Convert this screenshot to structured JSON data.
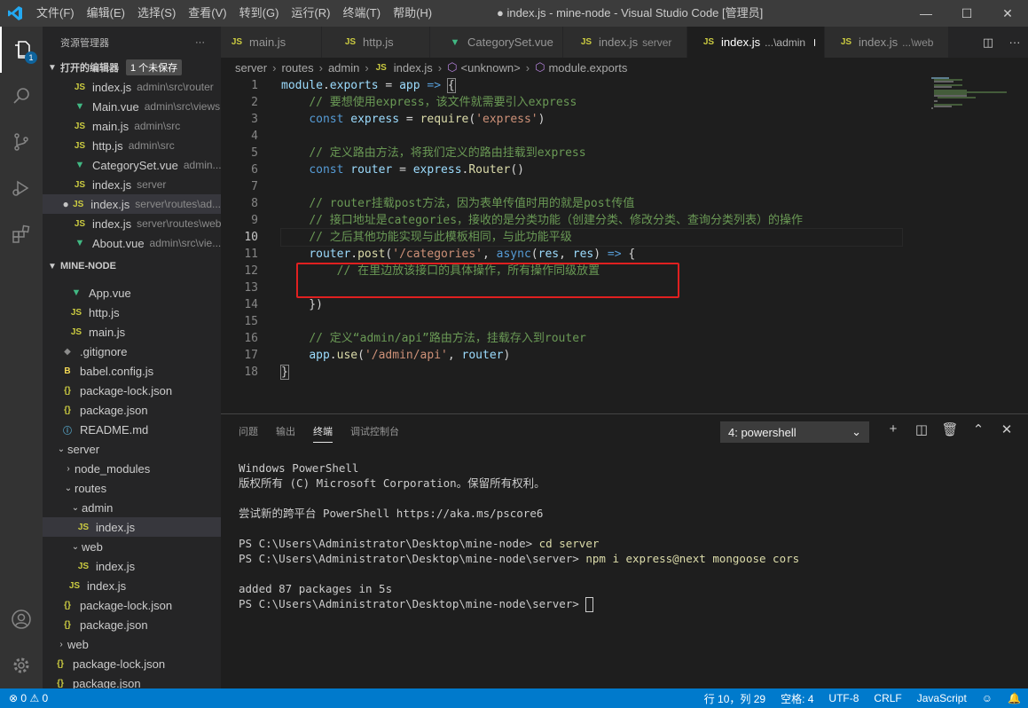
{
  "titlebar": {
    "menu": [
      "文件(F)",
      "编辑(E)",
      "选择(S)",
      "查看(V)",
      "转到(G)",
      "运行(R)",
      "终端(T)",
      "帮助(H)"
    ],
    "title": "● index.js - mine-node - Visual Studio Code [管理员]"
  },
  "activity": {
    "badge": "1"
  },
  "sidebar": {
    "header": "资源管理器",
    "open_editors_title": "打开的编辑器",
    "unsaved_badge": "1 个未保存",
    "open_editors": [
      {
        "name": "index.js",
        "desc": "admin\\src\\router",
        "icon": "JS"
      },
      {
        "name": "Main.vue",
        "desc": "admin\\src\\views",
        "icon": "V"
      },
      {
        "name": "main.js",
        "desc": "admin\\src",
        "icon": "JS"
      },
      {
        "name": "http.js",
        "desc": "admin\\src",
        "icon": "JS"
      },
      {
        "name": "CategorySet.vue",
        "desc": "admin...",
        "icon": "V"
      },
      {
        "name": "index.js",
        "desc": "server",
        "icon": "JS"
      },
      {
        "name": "index.js",
        "desc": "server\\routes\\ad...",
        "icon": "JS"
      },
      {
        "name": "index.js",
        "desc": "server\\routes\\web",
        "icon": "JS"
      },
      {
        "name": "About.vue",
        "desc": "admin\\src\\vie...",
        "icon": "V"
      }
    ],
    "project_title": "MINE-NODE",
    "tree": [
      {
        "name": "App.vue",
        "icon": "V"
      },
      {
        "name": "http.js",
        "icon": "JS"
      },
      {
        "name": "main.js",
        "icon": "JS"
      },
      {
        "name": ".gitignore",
        "icon": "git"
      },
      {
        "name": "babel.config.js",
        "icon": "babel"
      },
      {
        "name": "package-lock.json",
        "icon": "{}"
      },
      {
        "name": "package.json",
        "icon": "{}"
      },
      {
        "name": "README.md",
        "icon": "i"
      },
      {
        "name": "server",
        "icon": "folder-open"
      },
      {
        "name": "node_modules",
        "icon": "folder"
      },
      {
        "name": "routes",
        "icon": "folder-open"
      },
      {
        "name": "admin",
        "icon": "folder-open"
      },
      {
        "name": "index.js",
        "icon": "JS"
      },
      {
        "name": "web",
        "icon": "folder-open"
      },
      {
        "name": "index.js",
        "icon": "JS"
      },
      {
        "name": "index.js",
        "icon": "JS"
      },
      {
        "name": "package-lock.json",
        "icon": "{}"
      },
      {
        "name": "package.json",
        "icon": "{}"
      },
      {
        "name": "web",
        "icon": "folder"
      },
      {
        "name": "package-lock.json",
        "icon": "{}"
      },
      {
        "name": "package.json",
        "icon": "{}"
      }
    ]
  },
  "tabs": [
    {
      "name": "main.js",
      "desc": "",
      "icon": "JS"
    },
    {
      "name": "http.js",
      "desc": "",
      "icon": "JS"
    },
    {
      "name": "CategorySet.vue",
      "desc": "",
      "icon": "V"
    },
    {
      "name": "index.js",
      "desc": "server",
      "icon": "JS"
    },
    {
      "name": "index.js",
      "desc": "...\\admin",
      "icon": "JS"
    },
    {
      "name": "index.js",
      "desc": "...\\web",
      "icon": "JS"
    }
  ],
  "breadcrumb": [
    "server",
    "routes",
    "admin",
    "index.js",
    "<unknown>",
    "module.exports"
  ],
  "code_comments": {
    "c2": "// 要想使用express，该文件就需要引入express",
    "c5": "// 定义路由方法，将我们定义的路由挂载到express",
    "c8": "// router挂载post方法，因为表单传值时用的就是post传值",
    "c9": "// 接口地址是categories，接收的是分类功能（创建分类、修改分类、查询分类列表）的操作",
    "c10": "// 之后其他功能实现与此模板相同，与此功能平级",
    "c12": "// 在里边放该接口的具体操作，所有操作同级放置",
    "c16": "// 定义“admin/api”路由方法，挂载存入到router"
  },
  "panel": {
    "tabs": [
      "问题",
      "输出",
      "终端",
      "调试控制台"
    ],
    "select": "4: powershell",
    "terminal": [
      "Windows PowerShell",
      "版权所有 (C) Microsoft Corporation。保留所有权利。",
      "",
      "尝试新的跨平台 PowerShell https://aka.ms/pscore6",
      "",
      "PS C:\\Users\\Administrator\\Desktop\\mine-node> ",
      "PS C:\\Users\\Administrator\\Desktop\\mine-node\\server> ",
      "",
      "added 87 packages in 5s",
      "PS C:\\Users\\Administrator\\Desktop\\mine-node\\server> "
    ],
    "cmd1": "cd server",
    "cmd2": "npm i express@next mongoose cors"
  },
  "status": {
    "errors": "0",
    "warnings": "0",
    "position": "行 10，列 29",
    "spaces": "空格: 4",
    "encoding": "UTF-8",
    "eol": "CRLF",
    "language": "JavaScript"
  }
}
